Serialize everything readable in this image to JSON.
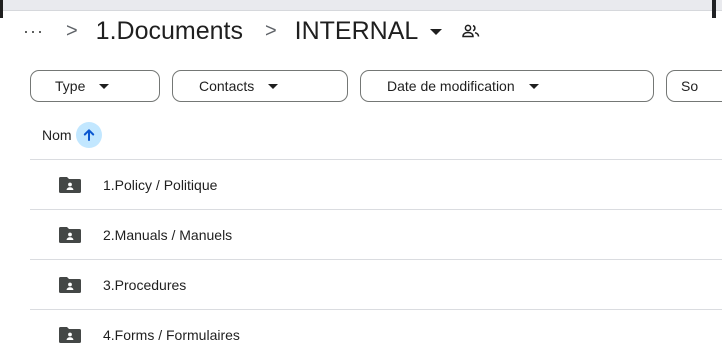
{
  "breadcrumb": {
    "more": "···",
    "sep1": ">",
    "parent": "1.Documents",
    "sep2": ">",
    "current": "INTERNAL"
  },
  "filters": {
    "type": "Type",
    "contacts": "Contacts",
    "date": "Date de modification",
    "sort": "So"
  },
  "list": {
    "column_name": "Nom",
    "items": [
      {
        "name": "1.Policy / Politique"
      },
      {
        "name": "2.Manuals / Manuels"
      },
      {
        "name": "3.Procedures"
      },
      {
        "name": "4.Forms / Formulaires"
      }
    ]
  },
  "colors": {
    "sort_highlight": "#c2e7ff",
    "folder": "#444746",
    "divider": "#dadce0"
  },
  "icons": {
    "more": "more-horizontal-icon",
    "shared": "people-icon",
    "sort": "arrow-up-icon",
    "folder": "shared-folder-icon"
  }
}
